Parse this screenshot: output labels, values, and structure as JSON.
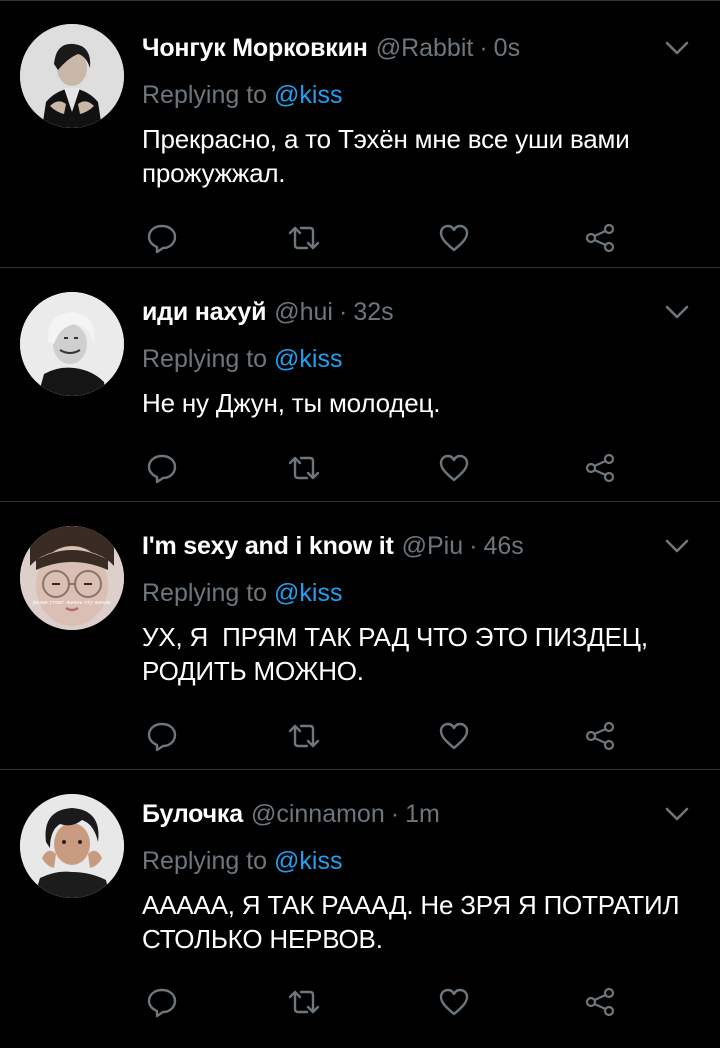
{
  "colors": {
    "background": "#000000",
    "divider": "#2f3336",
    "muted": "#6e767d",
    "link": "#1da1f2",
    "text": "#ffffff"
  },
  "icons": {
    "caret": "chevron-down-icon",
    "reply": "comment-icon",
    "retweet": "retweet-icon",
    "like": "heart-icon",
    "share": "share-icon"
  },
  "tweets": [
    {
      "name": "Чонгук Морковкин",
      "handle": "@Rabbit",
      "dot": "·",
      "time": "0s",
      "replying_label": "Replying to",
      "replying_handle": "@kiss",
      "text": "Прекрасно, а то Тэхён мне все уши вами прожужжал."
    },
    {
      "name": "иди нахуй",
      "handle": "@hui",
      "dot": "·",
      "time": "32s",
      "replying_label": "Replying to",
      "replying_handle": "@kiss",
      "text": "Не ну Джун, ты молодец."
    },
    {
      "name": "I'm sexy and i know it",
      "handle": "@Piu",
      "dot": "·",
      "time": "46s",
      "replying_label": "Replying to",
      "replying_handle": "@kiss",
      "text": "УХ, Я  ПРЯМ ТАК РАД ЧТО ЭТО ПИЗДЕЦ, РОДИТЬ МОЖНО.",
      "avatar_caption": "разве стоит жизнь эту жизнь"
    },
    {
      "name": "Булочка",
      "handle": "@cinnamon",
      "dot": "·",
      "time": "1m",
      "replying_label": "Replying to",
      "replying_handle": "@kiss",
      "text": "ААААА, Я ТАК РАААД. Не ЗРЯ Я ПОТРАТИЛ СТОЛЬКО НЕРВОВ."
    }
  ]
}
